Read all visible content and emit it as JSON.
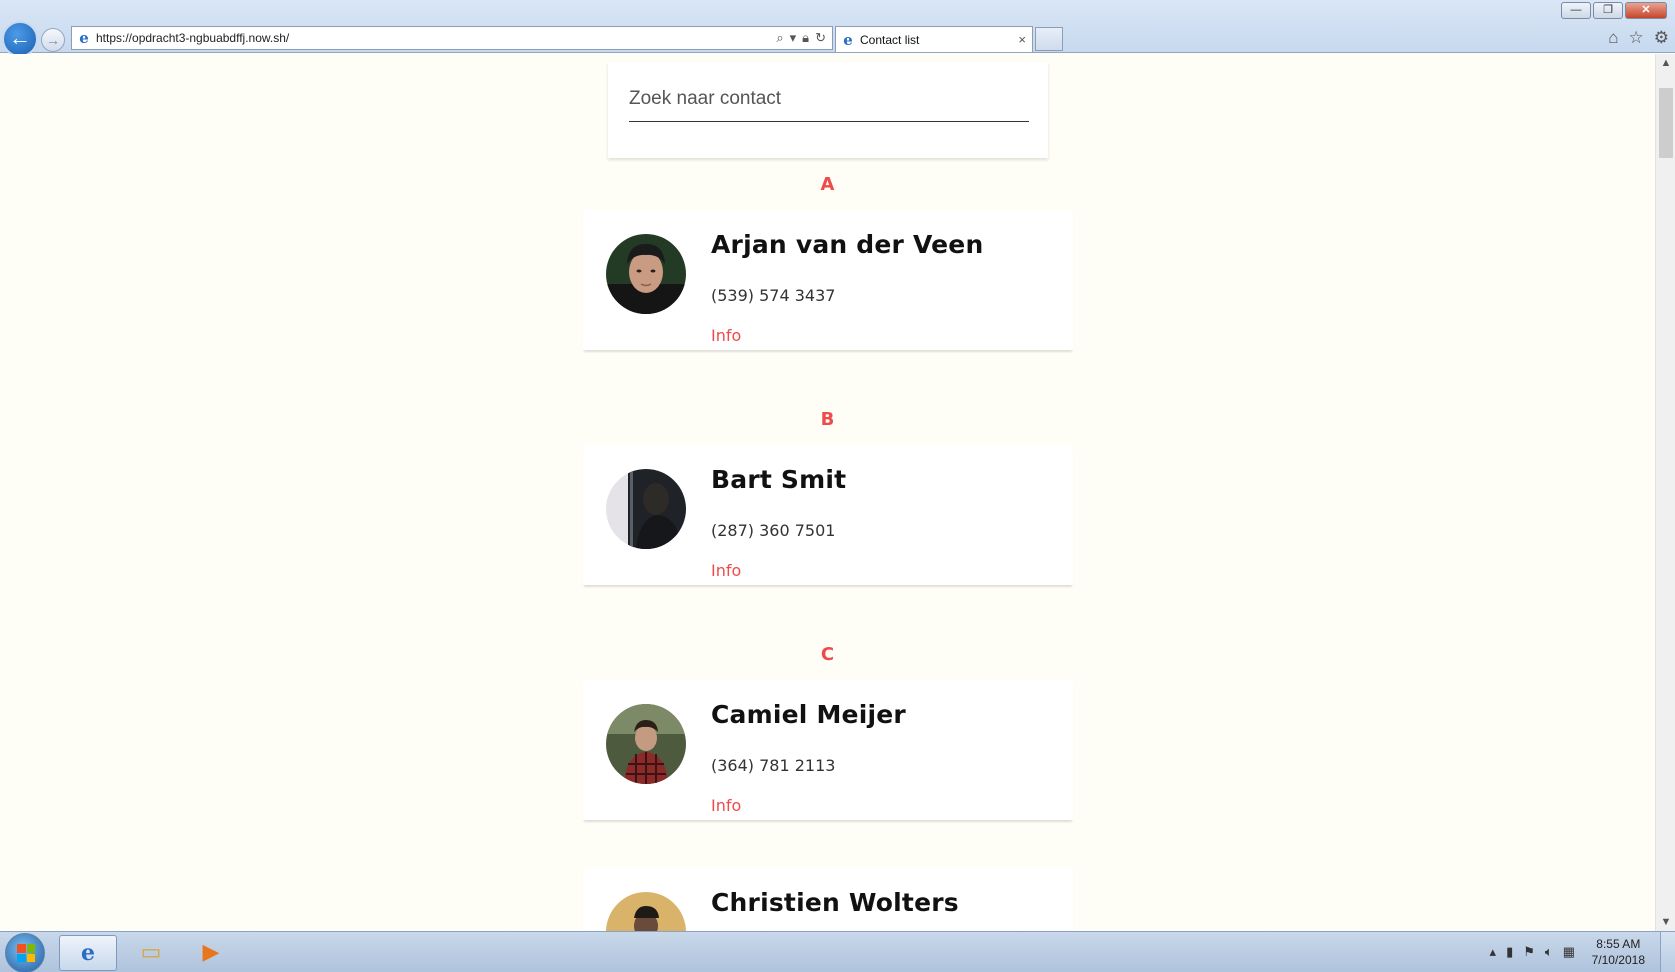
{
  "browser": {
    "url": "https://opdracht3-ngbuabdffj.now.sh/",
    "tab_title": "Contact list",
    "tab_close": "×",
    "back_glyph": "←",
    "forward_glyph": "→",
    "window_controls": {
      "minimize": "—",
      "restore": "❐",
      "close": "✕"
    },
    "icons": [
      "home-icon",
      "favorites-star-icon",
      "settings-gear-icon"
    ]
  },
  "search": {
    "placeholder": "Zoek naar contact",
    "value": ""
  },
  "groups": [
    {
      "letter": "A",
      "contacts": [
        {
          "name": "Arjan van der Veen",
          "phone": "(539) 574 3437",
          "info_label": "Info"
        }
      ]
    },
    {
      "letter": "B",
      "contacts": [
        {
          "name": "Bart Smit",
          "phone": "(287) 360 7501",
          "info_label": "Info"
        }
      ]
    },
    {
      "letter": "C",
      "contacts": [
        {
          "name": "Camiel Meijer",
          "phone": "(364) 781 2113",
          "info_label": "Info"
        },
        {
          "name": "Christien Wolters"
        }
      ]
    }
  ],
  "colors": {
    "accent": "#ef4b4b",
    "page_background": "#fffef6",
    "card_background": "#ffffff"
  },
  "taskbar": {
    "time": "8:55 AM",
    "date": "7/10/2018"
  }
}
